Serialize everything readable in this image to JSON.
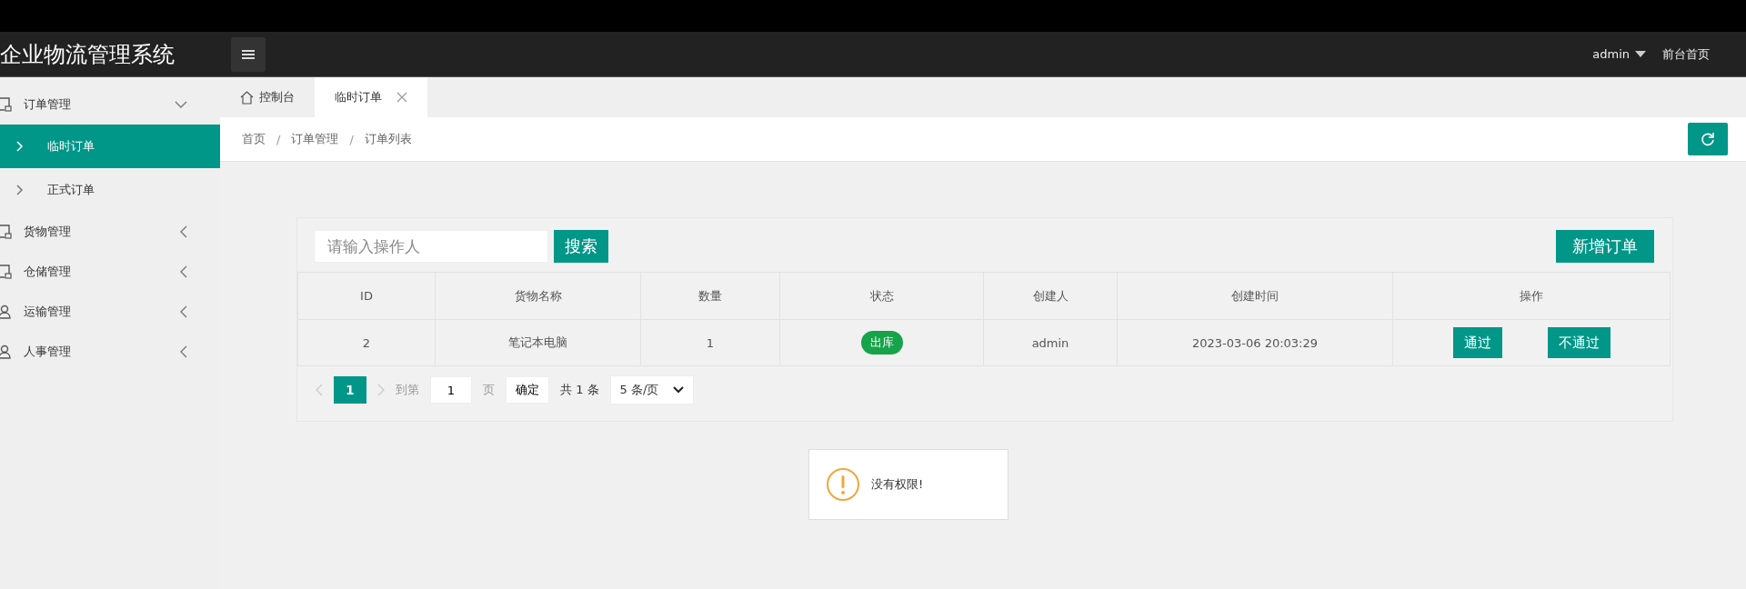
{
  "header": {
    "title": "企业物流管理系统",
    "user": "admin",
    "home_link": "前台首页"
  },
  "sidebar": {
    "items": [
      {
        "label": "订单管理",
        "kind": "document",
        "expanded": true,
        "children": [
          {
            "label": "临时订单",
            "selected": true
          },
          {
            "label": "正式订单",
            "selected": false
          }
        ]
      },
      {
        "label": "货物管理",
        "kind": "document",
        "expanded": false
      },
      {
        "label": "仓储管理",
        "kind": "document",
        "expanded": false
      },
      {
        "label": "运输管理",
        "kind": "person",
        "expanded": false
      },
      {
        "label": "人事管理",
        "kind": "person",
        "expanded": false
      }
    ]
  },
  "tabs": [
    {
      "label": "控制台",
      "kind": "home",
      "selected": false
    },
    {
      "label": "临时订单",
      "kind": "closable",
      "selected": true
    }
  ],
  "breadcrumb": [
    "首页",
    "订单管理",
    "订单列表"
  ],
  "breadcrumb_separator": "/",
  "search": {
    "placeholder": "请输入操作人",
    "button": "搜索"
  },
  "add_button": "新增订单",
  "table": {
    "columns": [
      "ID",
      "货物名称",
      "数量",
      "状态",
      "创建人",
      "创建时间",
      "操作"
    ],
    "rows": [
      {
        "id": "2",
        "name": "笔记本电脑",
        "quantity": "1",
        "status": "出库",
        "creator": "admin",
        "created": "2023-03-06 20:03:29",
        "actions": [
          "通过",
          "不通过"
        ]
      }
    ]
  },
  "pagination": {
    "pages": [
      {
        "label": "1",
        "selected": true
      }
    ],
    "goto_label": "到第",
    "goto_value": "1",
    "page_unit": "页",
    "confirm": "确定",
    "total": "共 1 条",
    "page_size": "5 条/页"
  },
  "message": {
    "text": "没有权限!"
  }
}
